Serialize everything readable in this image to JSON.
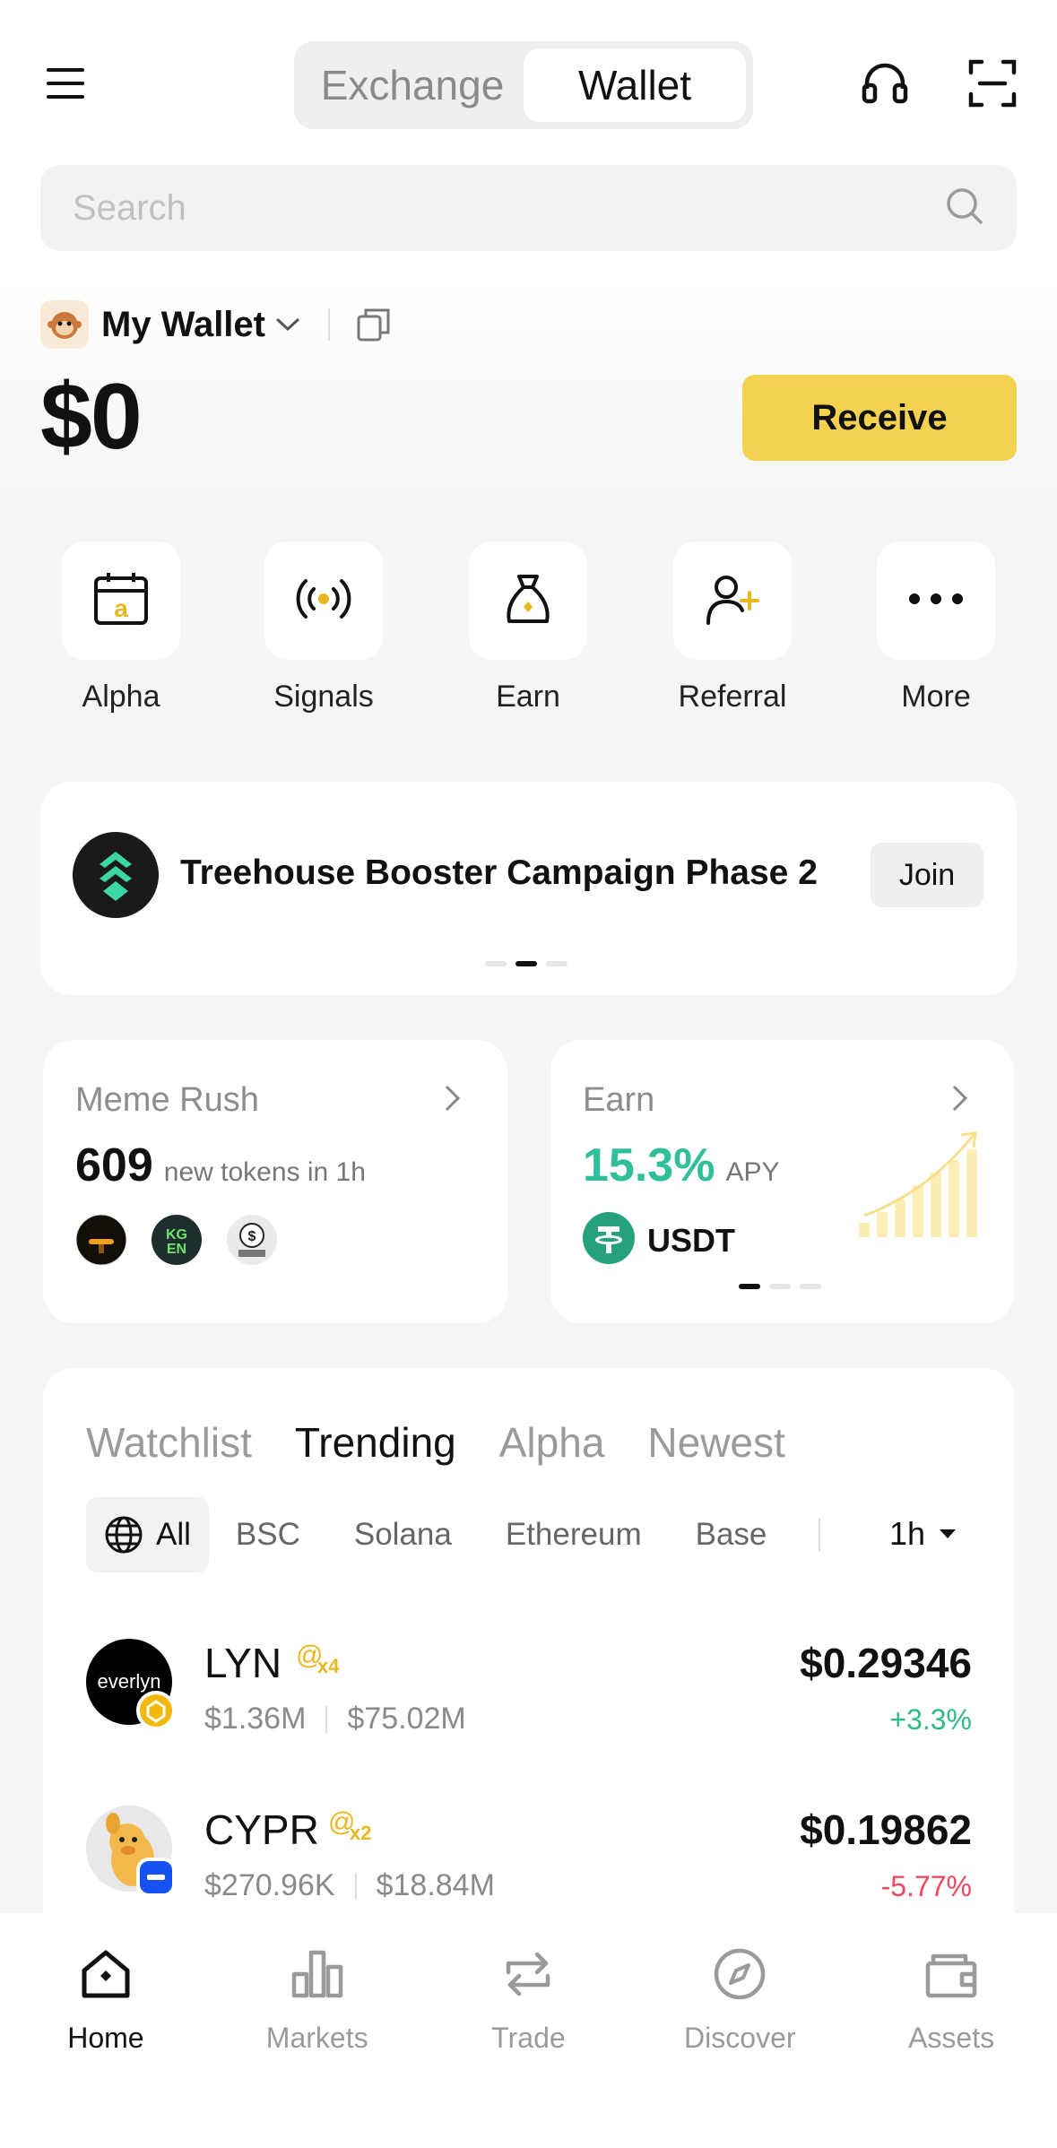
{
  "header": {
    "tabs": [
      {
        "label": "Exchange",
        "active": false
      },
      {
        "label": "Wallet",
        "active": true
      }
    ]
  },
  "search": {
    "placeholder": "Search"
  },
  "wallet": {
    "name": "My Wallet",
    "balance": "$0",
    "receive_label": "Receive"
  },
  "quick_actions": [
    {
      "label": "Alpha",
      "icon": "calendar-alpha-icon"
    },
    {
      "label": "Signals",
      "icon": "signal-icon"
    },
    {
      "label": "Earn",
      "icon": "money-bag-icon"
    },
    {
      "label": "Referral",
      "icon": "add-user-icon"
    },
    {
      "label": "More",
      "icon": "more-dots-icon"
    }
  ],
  "banner": {
    "title": "Treehouse Booster Campaign Phase 2",
    "join_label": "Join",
    "active_dot": 1,
    "dot_count": 3
  },
  "meme_rush": {
    "title": "Meme Rush",
    "count": "609",
    "count_label": "new tokens in 1h"
  },
  "earn_card": {
    "title": "Earn",
    "apy": "15.3%",
    "apy_label": "APY",
    "asset": "USDT",
    "active_dot": 0,
    "dot_count": 3
  },
  "market": {
    "tabs": [
      {
        "label": "Watchlist",
        "active": false
      },
      {
        "label": "Trending",
        "active": true
      },
      {
        "label": "Alpha",
        "active": false
      },
      {
        "label": "Newest",
        "active": false
      }
    ],
    "chains": [
      {
        "label": "All",
        "active": true
      },
      {
        "label": "BSC",
        "active": false
      },
      {
        "label": "Solana",
        "active": false
      },
      {
        "label": "Ethereum",
        "active": false
      },
      {
        "label": "Base",
        "active": false
      }
    ],
    "timeframe": "1h",
    "tokens": [
      {
        "symbol": "LYN",
        "logo_text": "everlyn",
        "badge": "x4",
        "liquidity": "$1.36M",
        "market_cap": "$75.02M",
        "price": "$0.29346",
        "change": "+3.3%",
        "direction": "up"
      },
      {
        "symbol": "CYPR",
        "logo_text": "",
        "badge": "x2",
        "liquidity": "$270.96K",
        "market_cap": "$18.84M",
        "price": "$0.19862",
        "change": "-5.77%",
        "direction": "down"
      }
    ]
  },
  "bottom_nav": [
    {
      "label": "Home",
      "icon": "home-icon",
      "active": true
    },
    {
      "label": "Markets",
      "icon": "bar-chart-icon",
      "active": false
    },
    {
      "label": "Trade",
      "icon": "swap-icon",
      "active": false
    },
    {
      "label": "Discover",
      "icon": "compass-icon",
      "active": false
    },
    {
      "label": "Assets",
      "icon": "wallet-icon",
      "active": false
    }
  ],
  "colors": {
    "accent": "#f3d251",
    "gain": "#2ebd85",
    "loss": "#f6465d",
    "teal": "#2fbf9a"
  }
}
